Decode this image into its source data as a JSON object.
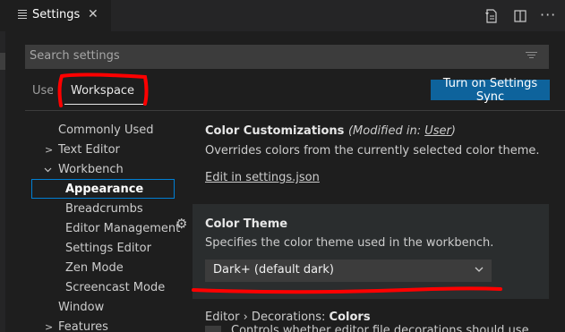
{
  "tab": {
    "title": "Settings",
    "close_glyph": "✕",
    "icon": "hamburger-icon"
  },
  "actions": {
    "open_json_icon": "open-settings-json-icon",
    "split_icon": "split-editor-icon",
    "more_glyph": "···"
  },
  "search": {
    "placeholder": "Search settings",
    "filter_icon": "filter-icon"
  },
  "scope": {
    "user_label": "User",
    "workspace_label": "Workspace",
    "sync_button": "Turn on Settings Sync"
  },
  "toc": {
    "items": [
      {
        "label": "Commonly Used",
        "chevron": ""
      },
      {
        "label": "Text Editor",
        "chevron": ">"
      },
      {
        "label": "Workbench",
        "chevron": "v"
      },
      {
        "label": "Appearance",
        "chevron": ""
      },
      {
        "label": "Breadcrumbs",
        "chevron": ""
      },
      {
        "label": "Editor Management",
        "chevron": ""
      },
      {
        "label": "Settings Editor",
        "chevron": ""
      },
      {
        "label": "Zen Mode",
        "chevron": ""
      },
      {
        "label": "Screencast Mode",
        "chevron": ""
      },
      {
        "label": "Window",
        "chevron": ""
      },
      {
        "label": "Features",
        "chevron": ">"
      }
    ]
  },
  "settings": {
    "color_customizations": {
      "title": "Color Customizations",
      "modified_prefix": "(Modified in: ",
      "modified_scope": "User",
      "modified_suffix": ")",
      "description": "Overrides colors from the currently selected color theme.",
      "link": "Edit in settings.json"
    },
    "color_theme": {
      "title": "Color Theme",
      "description": "Specifies the color theme used in the workbench.",
      "value": "Dark+ (default dark)"
    },
    "decorations": {
      "title_prefix": "Editor › Decorations: ",
      "title": "Colors",
      "peek_text": "Controls whether editor file decorations should use colors."
    }
  },
  "colors": {
    "accent": "#0e639c",
    "focus_border": "#007fd4",
    "annotation": "#ff0000",
    "background": "#1e1e1e"
  }
}
